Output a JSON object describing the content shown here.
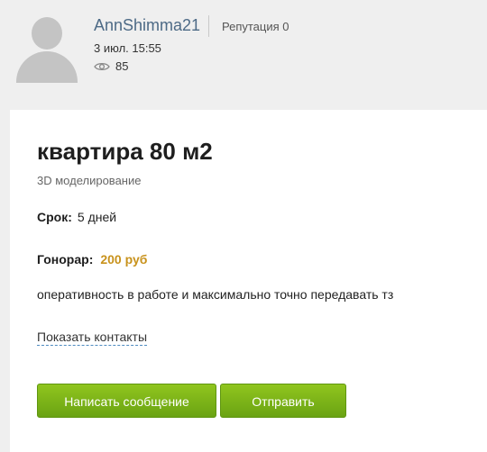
{
  "author": {
    "username": "AnnShimma21",
    "reputation": "Репутация 0",
    "datetime": "3 июл. 15:55",
    "views": "85"
  },
  "icons": {
    "avatar": "default-user-avatar",
    "views": "eye-icon"
  },
  "order": {
    "title": "квартира 80 м2",
    "category": "3D моделирование",
    "term_label": "Срок:",
    "term_value": "5 дней",
    "fee_label": "Гонорар:",
    "fee_value": "200 руб",
    "description": "оперативность в работе и максимально точно передавать тз",
    "contacts_link": "Показать контакты"
  },
  "actions": {
    "message_button": "Написать сообщение",
    "send_button": "Отправить"
  },
  "colors": {
    "username": "#4d6a86",
    "fee": "#c8921c",
    "button": "#7ab417",
    "background": "#efefef"
  }
}
